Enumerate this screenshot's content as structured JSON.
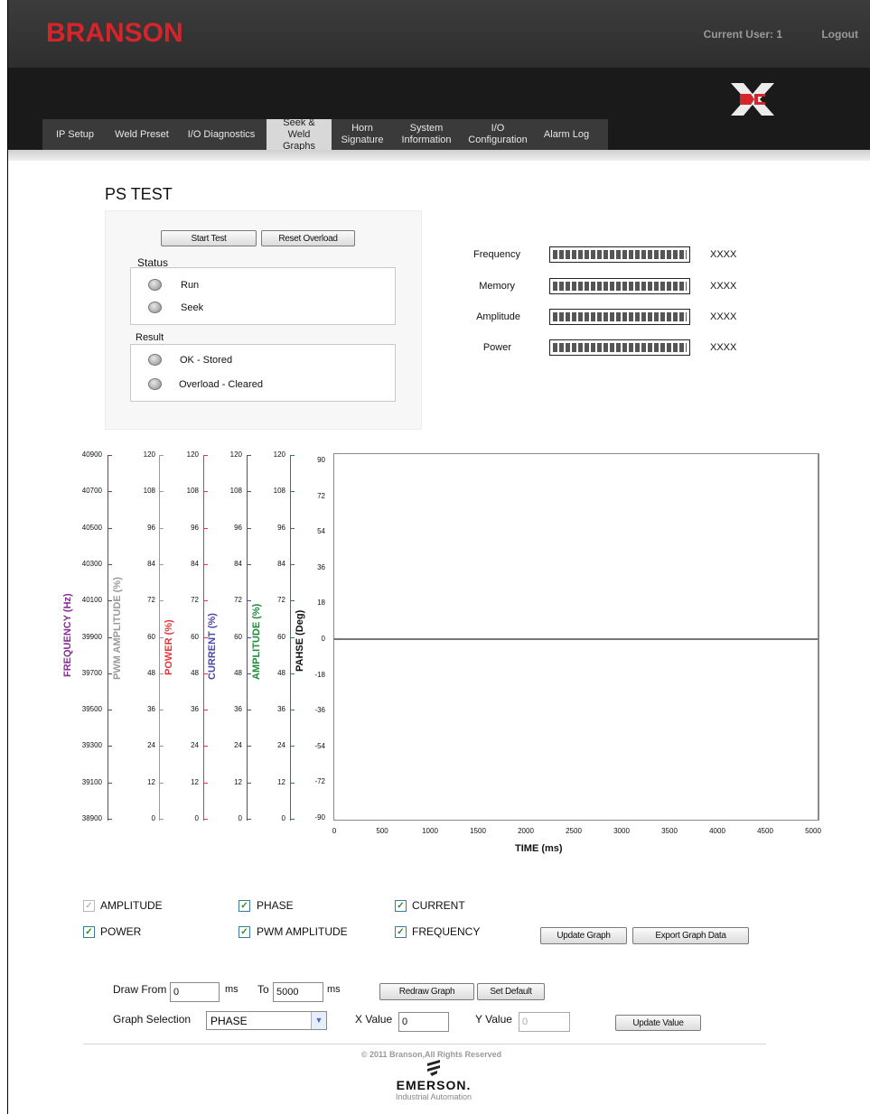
{
  "app": {
    "brand": "BRANSON",
    "current_user": "Current User: 1",
    "logout": "Logout",
    "brand_color": "#d6242b"
  },
  "nav": {
    "tabs": [
      {
        "label": "IP Setup",
        "active": false
      },
      {
        "label": "Weld Preset",
        "active": false
      },
      {
        "label": "I/O Diagnostics",
        "active": false
      },
      {
        "label": "Seek &\nWeld Graphs",
        "active": true
      },
      {
        "label": "Horn\nSignature",
        "active": false
      },
      {
        "label": "System\nInformation",
        "active": false
      },
      {
        "label": "I/O\nConfiguration",
        "active": false
      },
      {
        "label": "Alarm Log",
        "active": false
      }
    ]
  },
  "ps_test": {
    "title": "PS TEST",
    "start_test": "Start Test",
    "reset_overload": "Reset Overload",
    "status_label": "Status",
    "status_run": "Run",
    "status_seek": "Seek",
    "result_label": "Result",
    "result_ok": "OK - Stored",
    "result_overload": "Overload - Cleared"
  },
  "meters": [
    {
      "label": "Frequency",
      "value": "XXXX"
    },
    {
      "label": "Memory",
      "value": "XXXX"
    },
    {
      "label": "Amplitude",
      "value": "XXXX"
    },
    {
      "label": "Power",
      "value": "XXXX"
    }
  ],
  "graph": {
    "freq_ticks": [
      "40900",
      "40700",
      "40500",
      "40300",
      "40100",
      "39900",
      "39700",
      "39500",
      "39300",
      "39100",
      "38900"
    ],
    "pct_ticks": [
      "120",
      "108",
      "96",
      "84",
      "72",
      "60",
      "48",
      "36",
      "24",
      "12",
      "0"
    ],
    "phase_ticks": [
      "90",
      "72",
      "54",
      "36",
      "18",
      "0",
      "-18",
      "-36",
      "-54",
      "-72",
      "-90"
    ],
    "x_ticks": [
      "0",
      "500",
      "1000",
      "1500",
      "2000",
      "2500",
      "3000",
      "3500",
      "4000",
      "4500",
      "5000"
    ],
    "axis_titles": {
      "frequency": "FREQUENCY (Hz)",
      "pwm": "PWM AMPLITUDE (%)",
      "power": "POWER (%)",
      "current": "CURRENT (%)",
      "amplitude": "AMPLITUDE (%)",
      "phase": "PAHSE (Deg)",
      "time": "TIME (ms)"
    },
    "colors": {
      "frequency": "#8b2a9a",
      "pwm": "#9a9a9a",
      "power": "#e8353a",
      "current": "#4a4aa8",
      "amplitude": "#1f8a3a",
      "phase": "#111111"
    }
  },
  "checkboxes": {
    "amplitude": "AMPLITUDE",
    "phase": "PHASE",
    "current": "CURRENT",
    "power": "POWER",
    "pwm_amplitude": "PWM AMPLITUDE",
    "frequency": "FREQUENCY"
  },
  "buttons": {
    "update_graph": "Update Graph",
    "export_graph_data": "Export Graph Data",
    "redraw_graph": "Redraw Graph",
    "set_default": "Set Default",
    "update_value": "Update Value"
  },
  "controls": {
    "draw_from_label": "Draw From",
    "draw_from_value": "0",
    "ms1": "ms",
    "to_label": "To",
    "to_value": "5000",
    "ms2": "ms",
    "graph_selection_label": "Graph Selection",
    "graph_selection_value": "PHASE",
    "x_value_label": "X Value",
    "x_value": "0",
    "y_value_label": "Y Value",
    "y_value": "0"
  },
  "footer": {
    "copyright": "© 2011 Branson,All Rights Reserved",
    "company": "EMERSON.",
    "division": "Industrial Automation"
  }
}
